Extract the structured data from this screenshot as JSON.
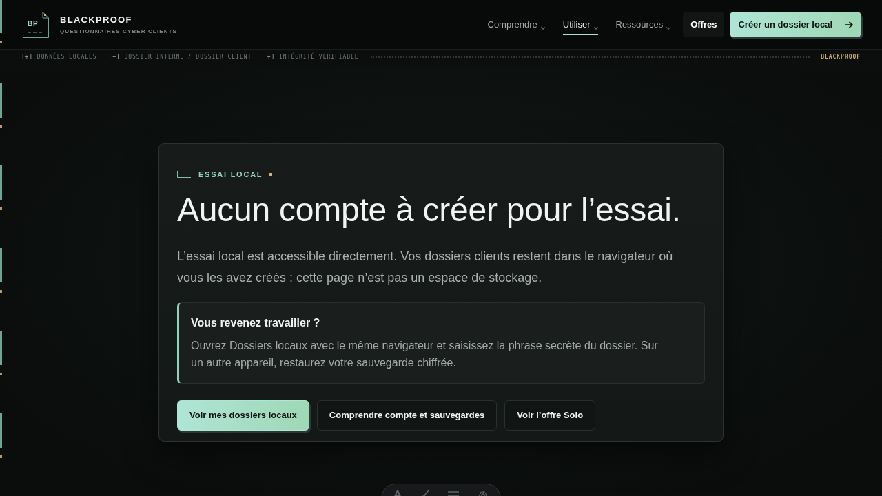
{
  "brand": {
    "logo_text": "BP",
    "name": "BLACKPROOF",
    "tagline": "QUESTIONNAIRES CYBER CLIENTS"
  },
  "nav": {
    "items": [
      {
        "label": "Comprendre",
        "kind": "dropdown",
        "selected": false
      },
      {
        "label": "Utiliser",
        "kind": "dropdown",
        "selected": true
      },
      {
        "label": "Ressources",
        "kind": "dropdown",
        "selected": false
      },
      {
        "label": "Offres",
        "kind": "featured",
        "selected": false
      }
    ],
    "cta": "Créer un dossier local"
  },
  "ticker": {
    "items": [
      {
        "marker": "[+]",
        "label": "DONNÉES LOCALES"
      },
      {
        "marker": "[+]",
        "label": "DOSSIER INTERNE / DOSSIER CLIENT"
      },
      {
        "marker": "[+]",
        "label": "INTÉGRITÉ VÉRIFIABLE"
      }
    ],
    "brand": "BLACKPROOF"
  },
  "card": {
    "eyebrow": "ESSAI LOCAL",
    "title": "Aucun compte à créer pour l’essai.",
    "lead": "L’essai local est accessible directement. Vos dossiers clients restent dans le navigateur où vous les avez créés : cette page n’est pas un espace de stockage.",
    "callout": {
      "title": "Vous revenez travailler ?",
      "text": "Ouvrez Dossiers locaux avec le même navigateur et saisissez la phrase secrète du dossier. Sur un autre appareil, restaurez votre sauvegarde chiffrée."
    },
    "buttons": [
      {
        "label": "Voir mes dossiers locaux",
        "kind": "primary"
      },
      {
        "label": "Comprendre compte et sauvegardes",
        "kind": "secondary"
      },
      {
        "label": "Voir l’offre Solo",
        "kind": "secondary"
      }
    ]
  }
}
